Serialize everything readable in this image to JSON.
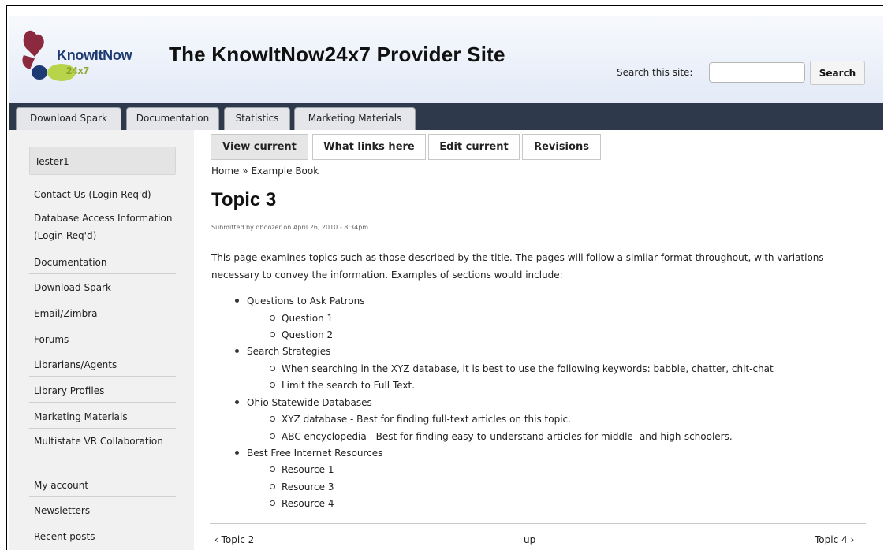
{
  "header": {
    "logo_text_top": "KnowItNow",
    "logo_text_bottom": "24x7",
    "site_title": "The KnowItNow24x7 Provider Site",
    "search_label": "Search this site:",
    "search_value": "",
    "search_button": "Search"
  },
  "tabs": [
    {
      "label": "Download Spark"
    },
    {
      "label": "Documentation"
    },
    {
      "label": "Statistics"
    },
    {
      "label": "Marketing Materials"
    }
  ],
  "sidebar": {
    "user": "Tester1",
    "items": [
      {
        "label": "Contact Us (Login Req'd)"
      },
      {
        "label": "Database Access Information (Login Req'd)"
      },
      {
        "label": "Documentation"
      },
      {
        "label": "Download Spark"
      },
      {
        "label": "Email/Zimbra"
      },
      {
        "label": "Forums"
      },
      {
        "label": "Librarians/Agents"
      },
      {
        "label": "Library Profiles"
      },
      {
        "label": "Marketing Materials"
      },
      {
        "label": "Multistate VR Collaboration"
      },
      {
        "label": "My account"
      },
      {
        "label": "Newsletters"
      },
      {
        "label": "Recent posts"
      }
    ]
  },
  "actions": [
    {
      "label": "View current",
      "active": true
    },
    {
      "label": "What links here"
    },
    {
      "label": "Edit current"
    },
    {
      "label": "Revisions"
    }
  ],
  "breadcrumb": {
    "home": "Home",
    "separator": "»",
    "book": "Example Book"
  },
  "page": {
    "title": "Topic 3",
    "submitted": "Submitted by dboozer on April 26, 2010 - 8:34pm",
    "intro": "This page examines topics such as those described by the title. The pages will follow a similar format throughout, with variations necessary to convey the information. Examples of sections would include:",
    "sections": [
      {
        "label": "Questions to Ask Patrons",
        "items": [
          "Question 1",
          "Question 2"
        ]
      },
      {
        "label": "Search Strategies",
        "items": [
          "When searching in the XYZ database, it is best to use the following keywords: babble, chatter, chit-chat",
          "Limit the search to Full Text."
        ]
      },
      {
        "label": "Ohio Statewide Databases",
        "items": [
          "XYZ database - Best for finding full-text articles on this topic.",
          "ABC encyclopedia - Best for finding easy-to-understand articles for middle- and high-schoolers."
        ]
      },
      {
        "label": "Best Free Internet Resources",
        "items": [
          "Resource 1",
          "Resource 3",
          "Resource 4"
        ]
      }
    ]
  },
  "pager": {
    "prev": "‹ Topic 2",
    "up": "up",
    "next": "Topic 4 ›"
  }
}
